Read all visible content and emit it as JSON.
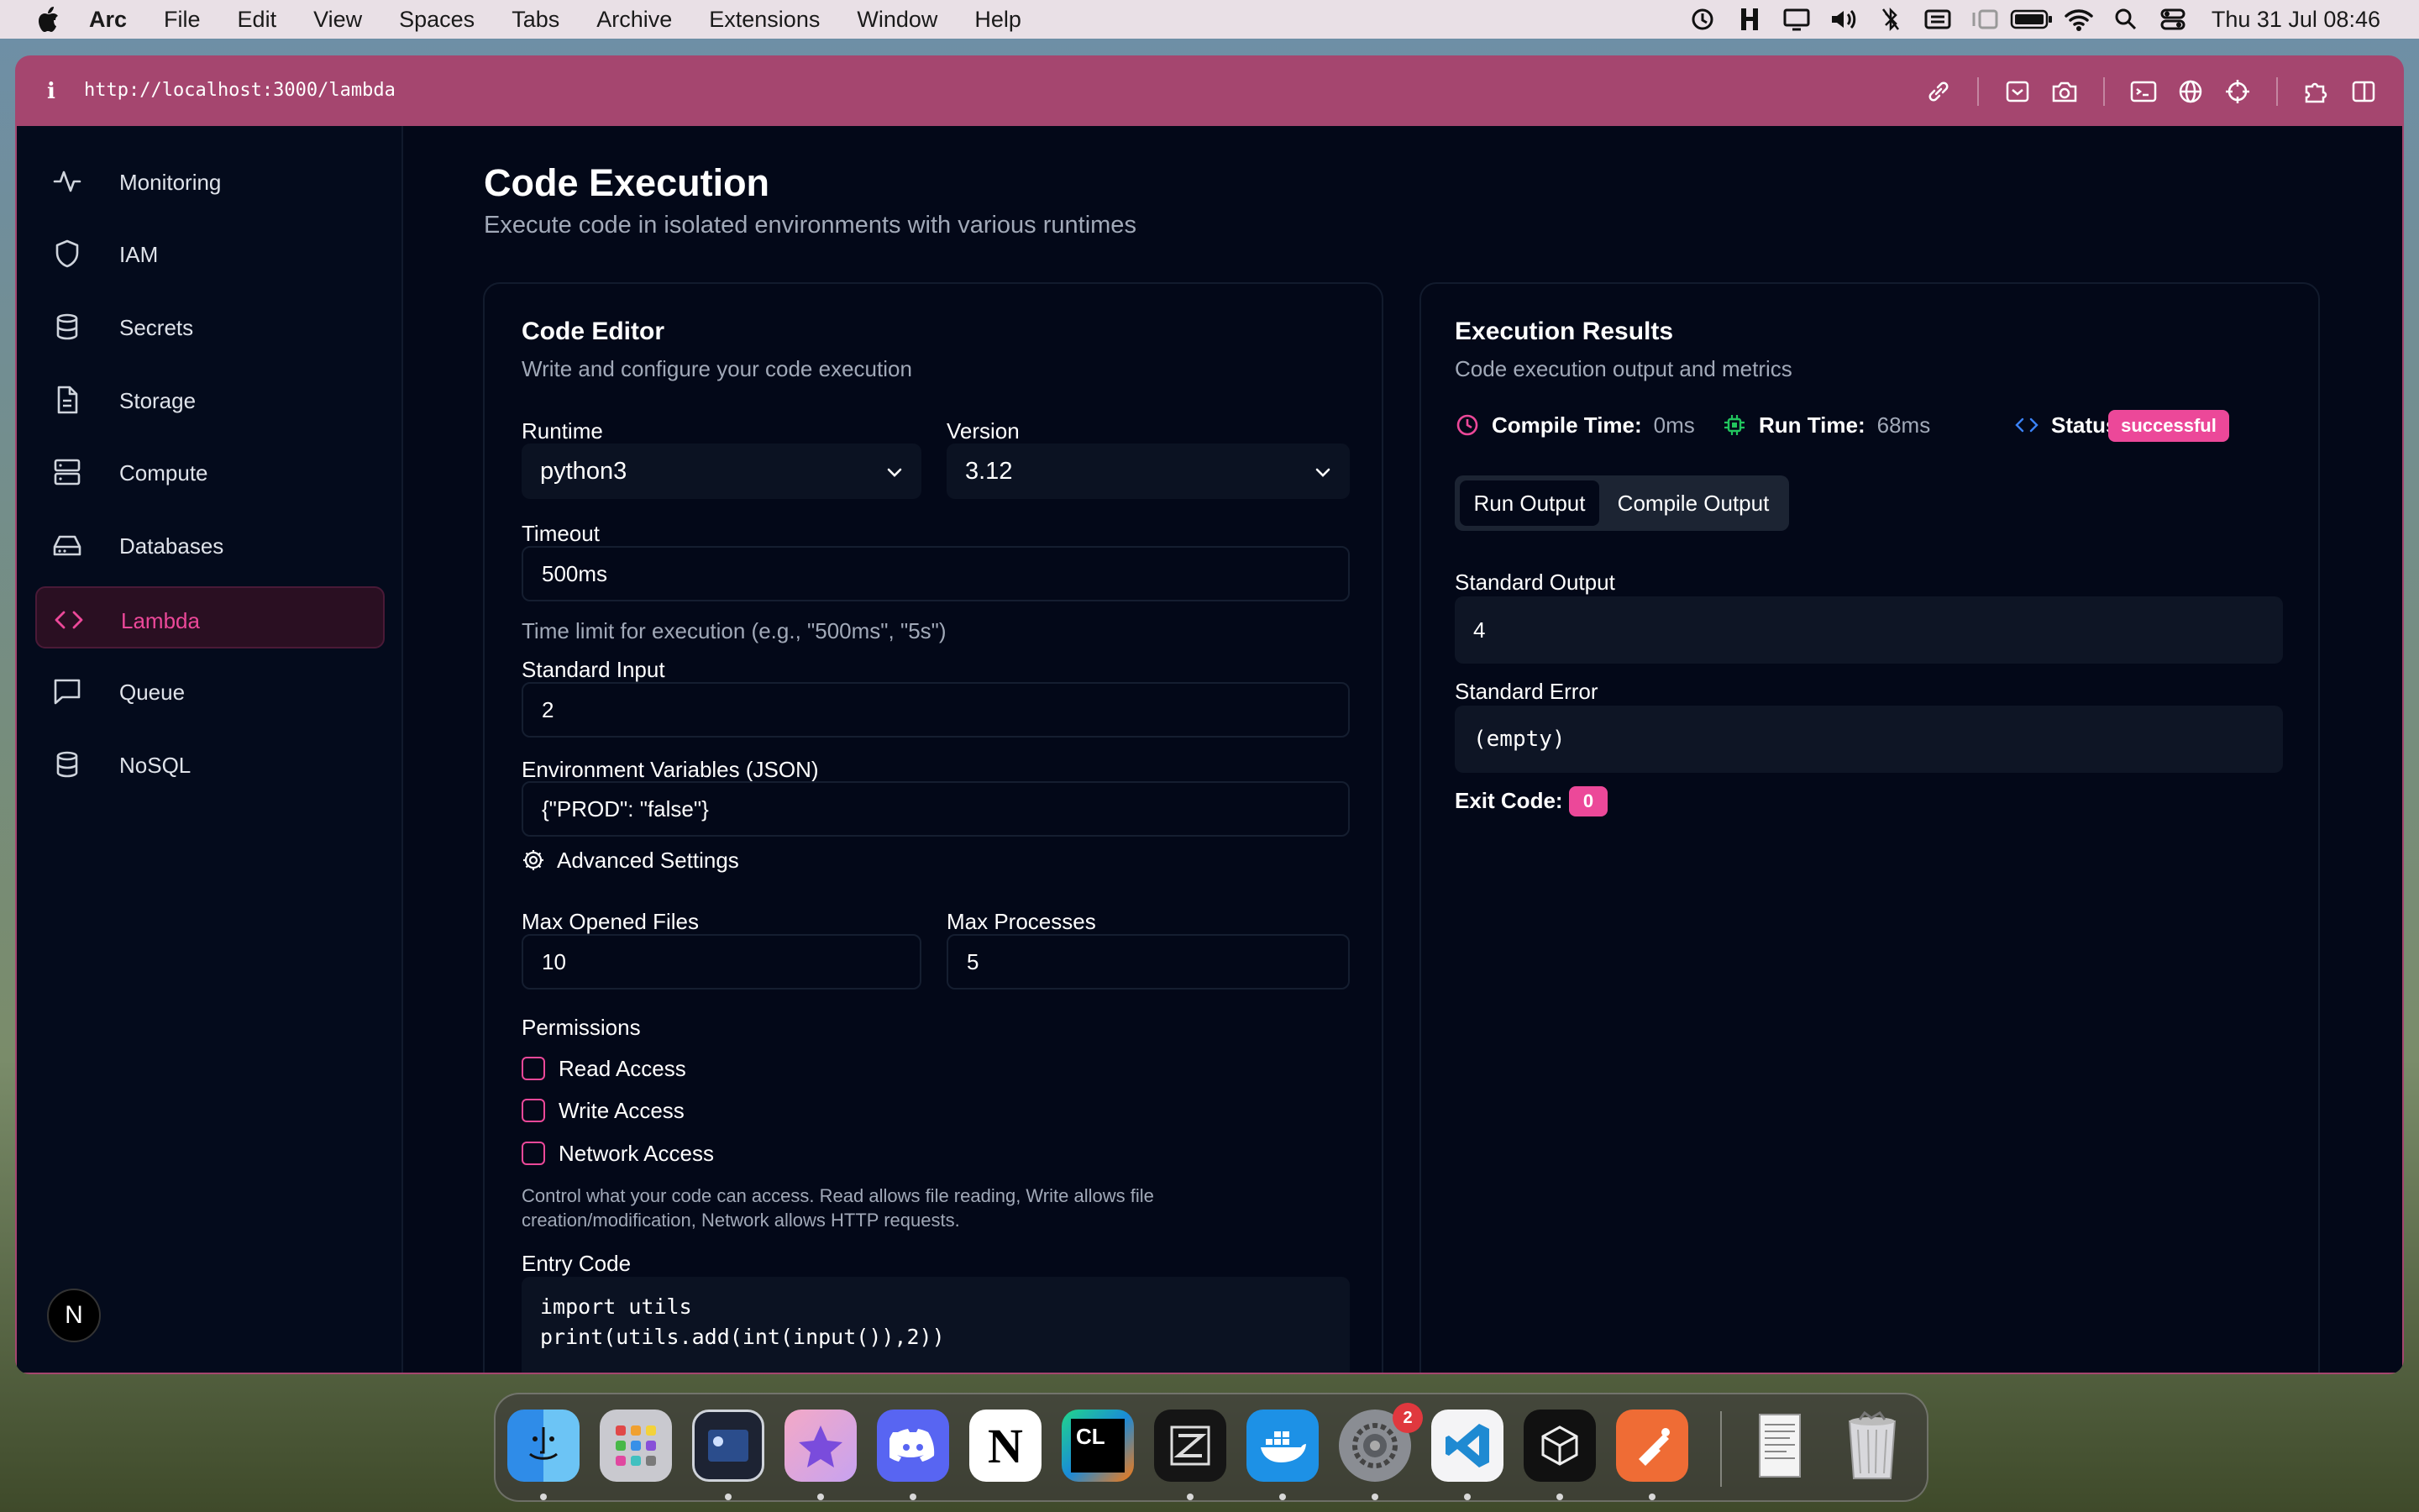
{
  "menubar": {
    "app": "Arc",
    "items": [
      "File",
      "Edit",
      "View",
      "Spaces",
      "Tabs",
      "Archive",
      "Extensions",
      "Window",
      "Help"
    ],
    "clock": "Thu 31 Jul  08:46"
  },
  "browser": {
    "info_glyph": "i",
    "url": "http://localhost:3000/lambda"
  },
  "sidebar": {
    "items": [
      {
        "label": "Monitoring",
        "icon": "activity-icon"
      },
      {
        "label": "IAM",
        "icon": "shield-icon"
      },
      {
        "label": "Secrets",
        "icon": "database-icon"
      },
      {
        "label": "Storage",
        "icon": "file-icon"
      },
      {
        "label": "Compute",
        "icon": "server-icon"
      },
      {
        "label": "Databases",
        "icon": "hard-drive-icon"
      },
      {
        "label": "Lambda",
        "icon": "code-icon",
        "active": true
      },
      {
        "label": "Queue",
        "icon": "message-icon"
      },
      {
        "label": "NoSQL",
        "icon": "database-icon"
      }
    ],
    "avatar": "N"
  },
  "page": {
    "title": "Code Execution",
    "subtitle": "Execute code in isolated environments with various runtimes"
  },
  "editor": {
    "title": "Code Editor",
    "subtitle": "Write and configure your code execution",
    "runtime_label": "Runtime",
    "runtime_value": "python3",
    "version_label": "Version",
    "version_value": "3.12",
    "timeout_label": "Timeout",
    "timeout_value": "500ms",
    "timeout_help": "Time limit for execution (e.g., \"500ms\", \"5s\")",
    "stdin_label": "Standard Input",
    "stdin_value": "2",
    "env_label": "Environment Variables (JSON)",
    "env_value": "{\"PROD\": \"false\"}",
    "advanced_label": "Advanced Settings",
    "max_files_label": "Max Opened Files",
    "max_files_value": "10",
    "max_proc_label": "Max Processes",
    "max_proc_value": "5",
    "permissions_label": "Permissions",
    "permissions": [
      {
        "label": "Read Access",
        "checked": false
      },
      {
        "label": "Write Access",
        "checked": false
      },
      {
        "label": "Network Access",
        "checked": false
      }
    ],
    "permissions_help_1": "Control what your code can access. Read allows file reading, Write allows file",
    "permissions_help_2": "creation/modification, Network allows HTTP requests.",
    "entry_label": "Entry Code",
    "entry_line1": "import utils",
    "entry_line2": "print(utils.add(int(input()),2))"
  },
  "results": {
    "title": "Execution Results",
    "subtitle": "Code execution output and metrics",
    "compile_label": "Compile Time:",
    "compile_value": "0ms",
    "run_label": "Run Time:",
    "run_value": "68ms",
    "status_label": "Status:",
    "status_value": "successful",
    "tabs": [
      "Run Output",
      "Compile Output"
    ],
    "stdout_label": "Standard Output",
    "stdout_value": "4",
    "stderr_label": "Standard Error",
    "stderr_value": "(empty)",
    "exit_label": "Exit Code:",
    "exit_value": "0"
  },
  "dock": {
    "apps": [
      "Finder",
      "Launchpad",
      "Terminal",
      "Affinity",
      "Discord",
      "Notion",
      "CLion",
      "Zed",
      "Docker",
      "System Settings",
      "VS Code",
      "Unity",
      "Postman",
      "Documents",
      "Trash"
    ],
    "settings_badge": "2",
    "notion_glyph": "N",
    "clion_glyph": "CL"
  },
  "colors": {
    "accent": "#ec4899",
    "window_frame": "#a5466f",
    "background": "#030818"
  }
}
